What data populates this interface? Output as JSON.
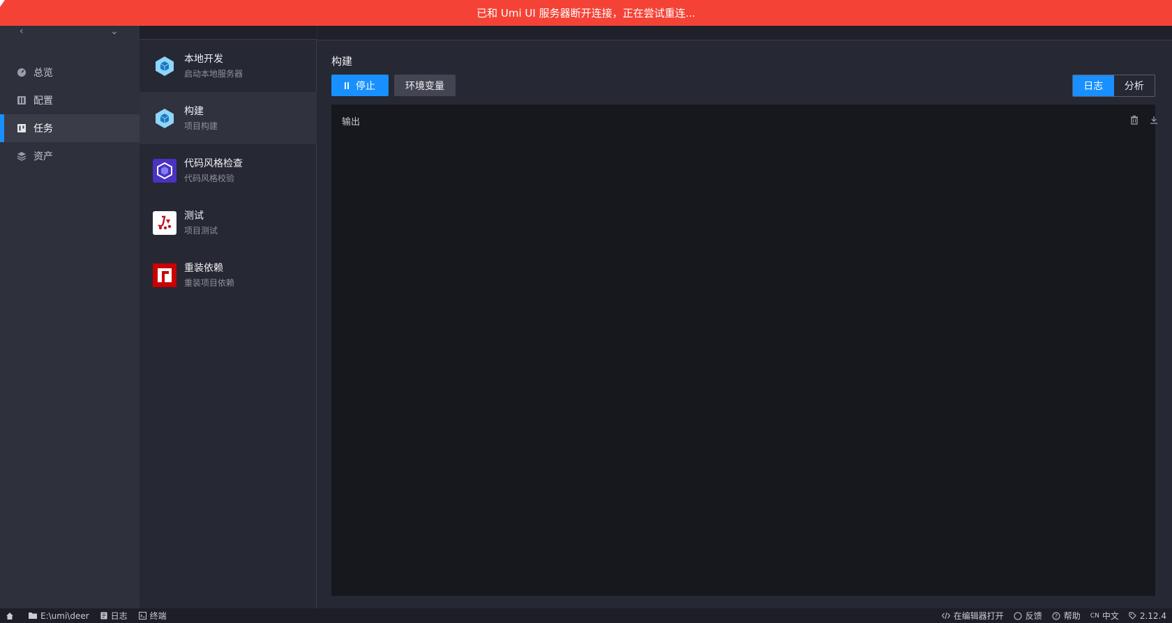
{
  "banner": {
    "message": "已和 Umi UI 服务器断开连接，正在尝试重连..."
  },
  "nav": {
    "items": [
      {
        "label": "总览",
        "icon": "dashboard-icon"
      },
      {
        "label": "配置",
        "icon": "config-icon"
      },
      {
        "label": "任务",
        "icon": "task-board-icon",
        "active": true
      },
      {
        "label": "资产",
        "icon": "layers-icon"
      }
    ]
  },
  "tasks": [
    {
      "title": "本地开发",
      "subtitle": "启动本地服务器",
      "icon": "webpack-icon"
    },
    {
      "title": "构建",
      "subtitle": "项目构建",
      "icon": "webpack-icon",
      "active": true
    },
    {
      "title": "代码风格检查",
      "subtitle": "代码风格校验",
      "icon": "eslint-icon"
    },
    {
      "title": "测试",
      "subtitle": "项目测试",
      "icon": "jest-icon"
    },
    {
      "title": "重装依赖",
      "subtitle": "重装项目依赖",
      "icon": "npm-icon"
    }
  ],
  "main": {
    "title": "构建",
    "stop_label": "停止",
    "env_label": "环境变量",
    "view_toggle": {
      "log": "日志",
      "analyze": "分析",
      "selected": "日志"
    },
    "output_title": "输出"
  },
  "status_bar": {
    "path": "E:\\umi\\deer",
    "log": "日志",
    "terminal": "终端",
    "open_editor": "在编辑器打开",
    "feedback": "反馈",
    "help": "帮助",
    "lang_code": "CN",
    "lang": "中文",
    "version": "2.12.4"
  },
  "colors": {
    "accent": "#1890ff",
    "banner": "#f44336",
    "bg": "#262834",
    "sidebar": "#2e303c",
    "output_bg": "#17181d"
  }
}
